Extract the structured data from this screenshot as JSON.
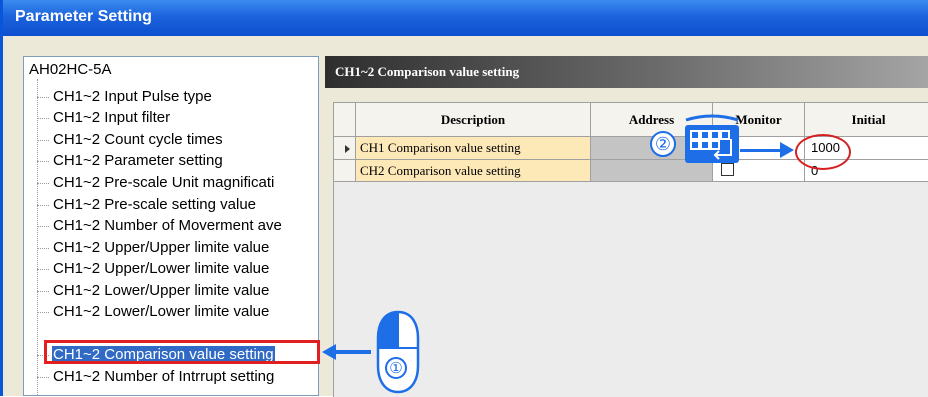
{
  "window": {
    "title": "Parameter Setting"
  },
  "tree": {
    "root": "AH02HC-5A",
    "items": [
      "CH1~2 Input Pulse type",
      "CH1~2 Input filter",
      "CH1~2 Count cycle times",
      "CH1~2 Parameter setting",
      "CH1~2 Pre-scale Unit magnificati",
      "CH1~2 Pre-scale setting value",
      "CH1~2 Number of Moverment ave",
      "CH1~2 Upper/Upper limite value",
      "CH1~2 Upper/Lower limite value",
      "CH1~2 Lower/Upper limite value",
      "CH1~2 Lower/Lower limite value",
      "CH1~2 Comparison value setting",
      "CH1~2 Number of Intrrupt setting"
    ],
    "selected_index": 11
  },
  "panel": {
    "header": "CH1~2 Comparison value setting",
    "columns": [
      "Description",
      "Address",
      "Monitor",
      "Initial"
    ],
    "rows": [
      {
        "description": "CH1 Comparison value setting",
        "address": "",
        "monitor": "",
        "initial": "1000",
        "current": true
      },
      {
        "description": "CH2 Comparison value setting",
        "address": "",
        "monitor": "checkbox-unchecked",
        "initial": "0",
        "current": false
      }
    ]
  },
  "annotations": {
    "step1": "①",
    "step2": "②",
    "step1_icon": "mouse-left-click-icon",
    "step2_icon": "keyboard-icon",
    "accent": "#1e6ee8",
    "highlight": "#e02020"
  }
}
